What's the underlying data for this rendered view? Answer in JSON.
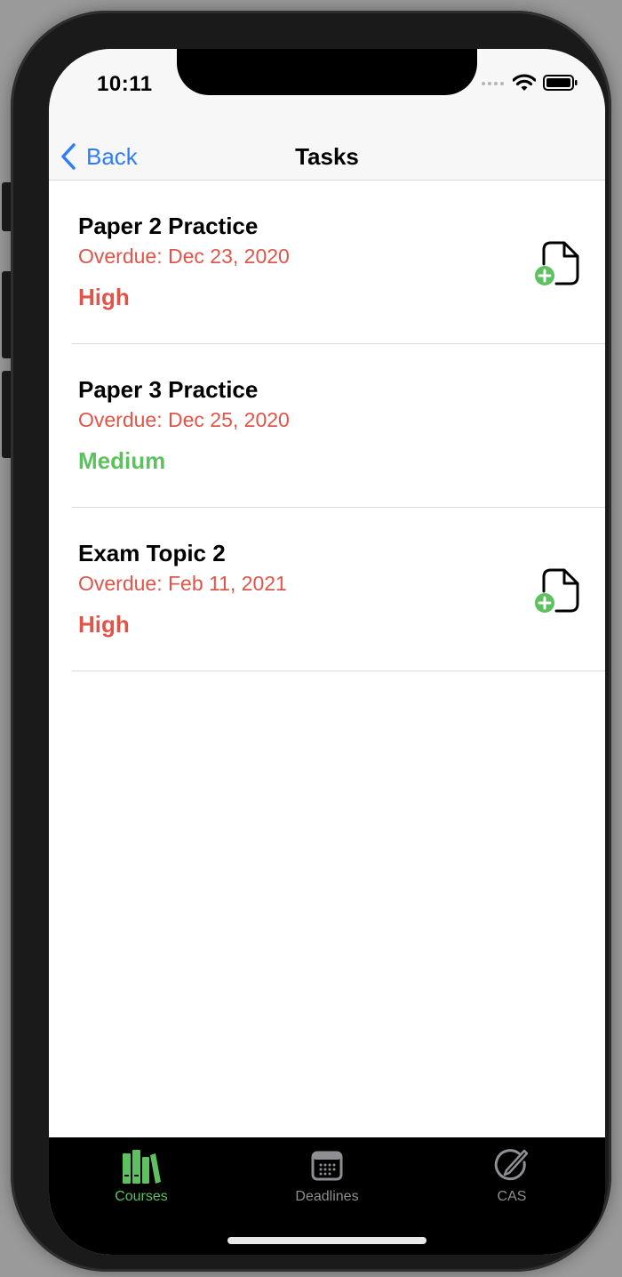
{
  "status_bar": {
    "time": "10:11"
  },
  "nav": {
    "back_label": "Back",
    "title": "Tasks"
  },
  "tasks": [
    {
      "title": "Paper 2 Practice",
      "due": "Overdue: Dec 23, 2020",
      "priority": "High",
      "priority_color": "#e0554a",
      "has_attachment_icon": true
    },
    {
      "title": "Paper 3 Practice",
      "due": "Overdue: Dec 25, 2020",
      "priority": "Medium",
      "priority_color": "#5cc15e",
      "has_attachment_icon": false
    },
    {
      "title": "Exam Topic 2",
      "due": "Overdue: Feb 11, 2021",
      "priority": "High",
      "priority_color": "#e0554a",
      "has_attachment_icon": true
    }
  ],
  "tab_bar": {
    "tabs": [
      {
        "label": "Courses",
        "icon": "books-icon",
        "selected": true
      },
      {
        "label": "Deadlines",
        "icon": "calendar-icon",
        "selected": false
      },
      {
        "label": "CAS",
        "icon": "compass-pen-icon",
        "selected": false
      }
    ],
    "active_color": "#5cc15e",
    "inactive_color": "#8e8e93"
  },
  "colors": {
    "accent_blue": "#2f7cf6",
    "overdue_red": "#e0554a",
    "add_green": "#5cc15e"
  }
}
